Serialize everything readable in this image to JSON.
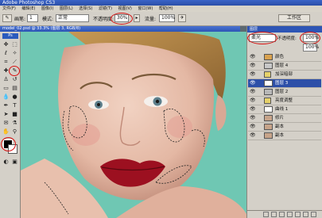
{
  "app": {
    "title": "Adobe Photoshop CS3"
  },
  "menu": [
    "文件(F)",
    "编辑(E)",
    "图像(I)",
    "图层(L)",
    "选择(S)",
    "滤镜(T)",
    "视图(V)",
    "窗口(W)",
    "帮助(H)"
  ],
  "options": {
    "brush_label": "画笔:",
    "brush_size": "1",
    "mode_label": "模式:",
    "mode_value": "正常",
    "opacity_label": "不透明度:",
    "opacity_value": "30%",
    "flow_label": "流量:",
    "flow_value": "100%",
    "workspace": "工作区"
  },
  "document": {
    "title": "model_02.psd @ 33.3% (图层 3, RGB/8)"
  },
  "toolbox": {
    "header": "Ps"
  },
  "layers": {
    "blend_mode": "柔光",
    "opacity_label": "不透明度:",
    "opacity_value": "100%",
    "fill_value": "100%",
    "items": [
      {
        "name": "颜色",
        "selected": false,
        "thumb": "#d9a24f"
      },
      {
        "name": "图层 4",
        "selected": false,
        "thumb": "#c8c8c8"
      },
      {
        "name": "加深暗部",
        "selected": false,
        "thumb": "#e6d26a"
      },
      {
        "name": "图层 3",
        "selected": true,
        "thumb": "#ffffff"
      },
      {
        "name": "图层 2",
        "selected": false,
        "thumb": "#b8b8b8"
      },
      {
        "name": "亮度调整",
        "selected": false,
        "thumb": "#e6d26a"
      },
      {
        "name": "曲线 1",
        "selected": false,
        "thumb": "#ffffff"
      },
      {
        "name": "修片",
        "selected": false,
        "thumb": "#c7a48a"
      },
      {
        "name": "副本",
        "selected": false,
        "thumb": "#c7a48a"
      },
      {
        "name": "副本",
        "selected": false,
        "thumb": "#c7a48a"
      }
    ]
  },
  "colors": {
    "canvas_bg": "#6fc7b3",
    "highlight": "#d81010",
    "selection": "#2d4fa8"
  }
}
